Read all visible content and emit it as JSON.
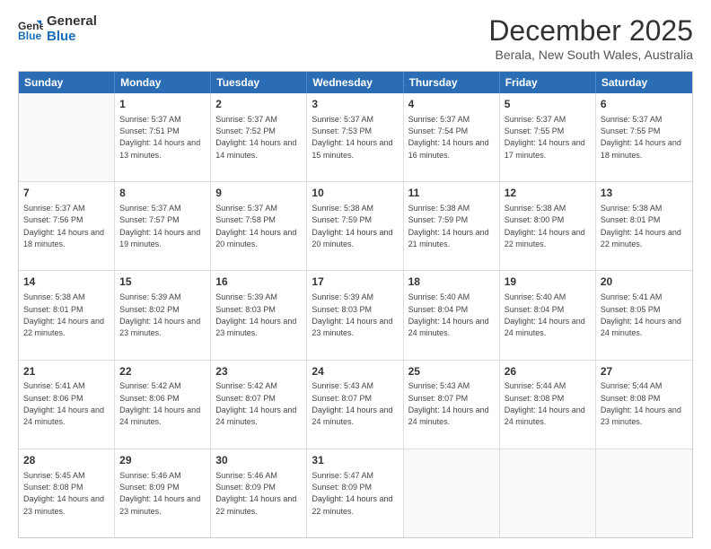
{
  "logo": {
    "line1": "General",
    "line2": "Blue"
  },
  "title": "December 2025",
  "subtitle": "Berala, New South Wales, Australia",
  "days_of_week": [
    "Sunday",
    "Monday",
    "Tuesday",
    "Wednesday",
    "Thursday",
    "Friday",
    "Saturday"
  ],
  "weeks": [
    [
      {
        "day": "",
        "empty": true
      },
      {
        "day": "1",
        "sunrise": "5:37 AM",
        "sunset": "7:51 PM",
        "daylight": "14 hours and 13 minutes."
      },
      {
        "day": "2",
        "sunrise": "5:37 AM",
        "sunset": "7:52 PM",
        "daylight": "14 hours and 14 minutes."
      },
      {
        "day": "3",
        "sunrise": "5:37 AM",
        "sunset": "7:53 PM",
        "daylight": "14 hours and 15 minutes."
      },
      {
        "day": "4",
        "sunrise": "5:37 AM",
        "sunset": "7:54 PM",
        "daylight": "14 hours and 16 minutes."
      },
      {
        "day": "5",
        "sunrise": "5:37 AM",
        "sunset": "7:55 PM",
        "daylight": "14 hours and 17 minutes."
      },
      {
        "day": "6",
        "sunrise": "5:37 AM",
        "sunset": "7:55 PM",
        "daylight": "14 hours and 18 minutes."
      }
    ],
    [
      {
        "day": "7",
        "sunrise": "5:37 AM",
        "sunset": "7:56 PM",
        "daylight": "14 hours and 18 minutes."
      },
      {
        "day": "8",
        "sunrise": "5:37 AM",
        "sunset": "7:57 PM",
        "daylight": "14 hours and 19 minutes."
      },
      {
        "day": "9",
        "sunrise": "5:37 AM",
        "sunset": "7:58 PM",
        "daylight": "14 hours and 20 minutes."
      },
      {
        "day": "10",
        "sunrise": "5:38 AM",
        "sunset": "7:59 PM",
        "daylight": "14 hours and 20 minutes."
      },
      {
        "day": "11",
        "sunrise": "5:38 AM",
        "sunset": "7:59 PM",
        "daylight": "14 hours and 21 minutes."
      },
      {
        "day": "12",
        "sunrise": "5:38 AM",
        "sunset": "8:00 PM",
        "daylight": "14 hours and 22 minutes."
      },
      {
        "day": "13",
        "sunrise": "5:38 AM",
        "sunset": "8:01 PM",
        "daylight": "14 hours and 22 minutes."
      }
    ],
    [
      {
        "day": "14",
        "sunrise": "5:38 AM",
        "sunset": "8:01 PM",
        "daylight": "14 hours and 22 minutes."
      },
      {
        "day": "15",
        "sunrise": "5:39 AM",
        "sunset": "8:02 PM",
        "daylight": "14 hours and 23 minutes."
      },
      {
        "day": "16",
        "sunrise": "5:39 AM",
        "sunset": "8:03 PM",
        "daylight": "14 hours and 23 minutes."
      },
      {
        "day": "17",
        "sunrise": "5:39 AM",
        "sunset": "8:03 PM",
        "daylight": "14 hours and 23 minutes."
      },
      {
        "day": "18",
        "sunrise": "5:40 AM",
        "sunset": "8:04 PM",
        "daylight": "14 hours and 24 minutes."
      },
      {
        "day": "19",
        "sunrise": "5:40 AM",
        "sunset": "8:04 PM",
        "daylight": "14 hours and 24 minutes."
      },
      {
        "day": "20",
        "sunrise": "5:41 AM",
        "sunset": "8:05 PM",
        "daylight": "14 hours and 24 minutes."
      }
    ],
    [
      {
        "day": "21",
        "sunrise": "5:41 AM",
        "sunset": "8:06 PM",
        "daylight": "14 hours and 24 minutes."
      },
      {
        "day": "22",
        "sunrise": "5:42 AM",
        "sunset": "8:06 PM",
        "daylight": "14 hours and 24 minutes."
      },
      {
        "day": "23",
        "sunrise": "5:42 AM",
        "sunset": "8:07 PM",
        "daylight": "14 hours and 24 minutes."
      },
      {
        "day": "24",
        "sunrise": "5:43 AM",
        "sunset": "8:07 PM",
        "daylight": "14 hours and 24 minutes."
      },
      {
        "day": "25",
        "sunrise": "5:43 AM",
        "sunset": "8:07 PM",
        "daylight": "14 hours and 24 minutes."
      },
      {
        "day": "26",
        "sunrise": "5:44 AM",
        "sunset": "8:08 PM",
        "daylight": "14 hours and 24 minutes."
      },
      {
        "day": "27",
        "sunrise": "5:44 AM",
        "sunset": "8:08 PM",
        "daylight": "14 hours and 23 minutes."
      }
    ],
    [
      {
        "day": "28",
        "sunrise": "5:45 AM",
        "sunset": "8:08 PM",
        "daylight": "14 hours and 23 minutes."
      },
      {
        "day": "29",
        "sunrise": "5:46 AM",
        "sunset": "8:09 PM",
        "daylight": "14 hours and 23 minutes."
      },
      {
        "day": "30",
        "sunrise": "5:46 AM",
        "sunset": "8:09 PM",
        "daylight": "14 hours and 22 minutes."
      },
      {
        "day": "31",
        "sunrise": "5:47 AM",
        "sunset": "8:09 PM",
        "daylight": "14 hours and 22 minutes."
      },
      {
        "day": "",
        "empty": true
      },
      {
        "day": "",
        "empty": true
      },
      {
        "day": "",
        "empty": true
      }
    ]
  ],
  "labels": {
    "sunrise_prefix": "Sunrise: ",
    "sunset_prefix": "Sunset: ",
    "daylight_prefix": "Daylight: "
  }
}
